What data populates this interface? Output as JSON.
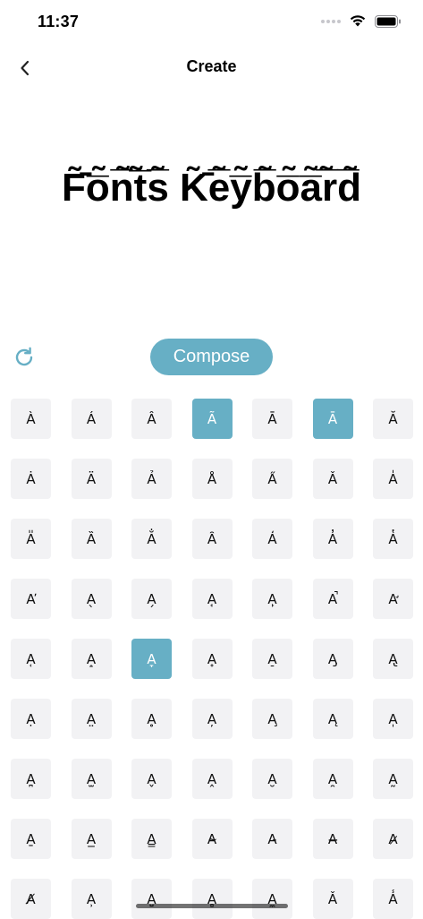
{
  "status_bar": {
    "time": "11:37"
  },
  "nav": {
    "title": "Create",
    "back_icon": "chevron-left-icon"
  },
  "preview": {
    "text": "F̃̄o̅̃n̅̃t̅̃s̅̃ K̃̄e̅̃y̅̃b̅̃o̅̃a̅̃r̅̃d̅̃"
  },
  "controls": {
    "refresh_icon": "refresh-icon",
    "compose_label": "Compose"
  },
  "colors": {
    "accent": "#67afc5",
    "cell_background": "#f2f2f4",
    "text": "#000000"
  },
  "grid": {
    "columns": 7,
    "rows": [
      {
        "cells": [
          {
            "glyph": "À",
            "selected": false
          },
          {
            "glyph": "Á",
            "selected": false
          },
          {
            "glyph": "Â",
            "selected": false
          },
          {
            "glyph": "Ã",
            "selected": true
          },
          {
            "glyph": "Ā",
            "selected": false
          },
          {
            "glyph": "Ā",
            "selected": true
          },
          {
            "glyph": "Ă",
            "selected": false
          }
        ]
      },
      {
        "cells": [
          {
            "glyph": "Ȧ",
            "selected": false
          },
          {
            "glyph": "Ä",
            "selected": false
          },
          {
            "glyph": "Ả",
            "selected": false
          },
          {
            "glyph": "Å",
            "selected": false
          },
          {
            "glyph": "A̋",
            "selected": false
          },
          {
            "glyph": "Ǎ",
            "selected": false
          },
          {
            "glyph": "A̍",
            "selected": false
          }
        ]
      },
      {
        "cells": [
          {
            "glyph": "A̎",
            "selected": false
          },
          {
            "glyph": "Ȁ",
            "selected": false
          },
          {
            "glyph": "A̐",
            "selected": false
          },
          {
            "glyph": "Ȃ",
            "selected": false
          },
          {
            "glyph": "A̒",
            "selected": false
          },
          {
            "glyph": "A̓",
            "selected": false
          },
          {
            "glyph": "A̔",
            "selected": false
          }
        ]
      },
      {
        "cells": [
          {
            "glyph": "A̕",
            "selected": false
          },
          {
            "glyph": "A̖",
            "selected": false
          },
          {
            "glyph": "A̗",
            "selected": false
          },
          {
            "glyph": "A̘",
            "selected": false
          },
          {
            "glyph": "A̙",
            "selected": false
          },
          {
            "glyph": "A̚",
            "selected": false
          },
          {
            "glyph": "A̛",
            "selected": false
          }
        ]
      },
      {
        "cells": [
          {
            "glyph": "A̜",
            "selected": false
          },
          {
            "glyph": "A̝",
            "selected": false
          },
          {
            "glyph": "A̞",
            "selected": true
          },
          {
            "glyph": "A̟",
            "selected": false
          },
          {
            "glyph": "A̠",
            "selected": false
          },
          {
            "glyph": "A̡",
            "selected": false
          },
          {
            "glyph": "A̢",
            "selected": false
          }
        ]
      },
      {
        "cells": [
          {
            "glyph": "Ạ",
            "selected": false
          },
          {
            "glyph": "A̤",
            "selected": false
          },
          {
            "glyph": "Ḁ",
            "selected": false
          },
          {
            "glyph": "A̦",
            "selected": false
          },
          {
            "glyph": "A̧",
            "selected": false
          },
          {
            "glyph": "Ą",
            "selected": false
          },
          {
            "glyph": "A̩",
            "selected": false
          }
        ]
      },
      {
        "cells": [
          {
            "glyph": "A̪",
            "selected": false
          },
          {
            "glyph": "A̫",
            "selected": false
          },
          {
            "glyph": "A̬",
            "selected": false
          },
          {
            "glyph": "A̭",
            "selected": false
          },
          {
            "glyph": "A̮",
            "selected": false
          },
          {
            "glyph": "A̯",
            "selected": false
          },
          {
            "glyph": "A̰",
            "selected": false
          }
        ]
      },
      {
        "cells": [
          {
            "glyph": "A̱",
            "selected": false
          },
          {
            "glyph": "A̲",
            "selected": false
          },
          {
            "glyph": "A̳",
            "selected": false
          },
          {
            "glyph": "A̴",
            "selected": false
          },
          {
            "glyph": "A̵",
            "selected": false
          },
          {
            "glyph": "A̶",
            "selected": false
          },
          {
            "glyph": "A̷",
            "selected": false
          }
        ]
      },
      {
        "cells": [
          {
            "glyph": "A̸",
            "selected": false
          },
          {
            "glyph": "A̹",
            "selected": false
          },
          {
            "glyph": "A̺",
            "selected": false
          },
          {
            "glyph": "A̻",
            "selected": false
          },
          {
            "glyph": "A̼",
            "selected": false
          },
          {
            "glyph": "Ǎ",
            "selected": false
          },
          {
            "glyph": "A̾",
            "selected": false
          }
        ]
      }
    ]
  }
}
